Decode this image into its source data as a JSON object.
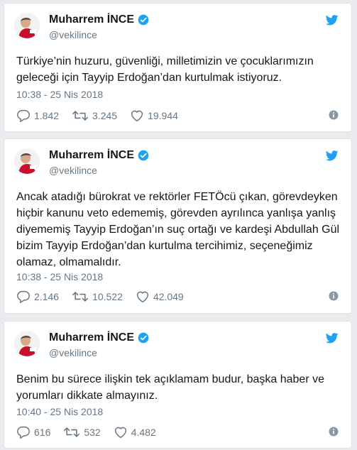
{
  "colors": {
    "accent": "#1da1f2",
    "text": "#14171a",
    "muted": "#657786",
    "verified": "#1da1f2"
  },
  "tweets": [
    {
      "name": "Muharrem İNCE",
      "handle": "@vekilince",
      "text": "Türkiye’nin huzuru, güvenliği, milletimizin ve çocuklarımızın geleceği için Tayyip Erdoğan’dan kurtulmak istiyoruz.",
      "timestamp": "10:38 - 25 Nis 2018",
      "replies": "1.842",
      "retweets": "3.245",
      "likes": "19.944"
    },
    {
      "name": "Muharrem İNCE",
      "handle": "@vekilince",
      "text": "Ancak atadığı bürokrat ve rektörler FETÖcü çıkan, görevdeyken hiçbir kanunu veto edememiş, görevden ayrılınca yanlışa yanlış diyememiş Tayyip Erdoğan’ın suç ortağı ve kardeşi Abdullah Gül bizim Tayyip Erdoğan’dan kurtulma tercihimiz, seçeneğimiz olamaz, olmamalıdır.",
      "timestamp": "10:38 - 25 Nis 2018",
      "replies": "2.146",
      "retweets": "10.522",
      "likes": "42.049"
    },
    {
      "name": "Muharrem İNCE",
      "handle": "@vekilince",
      "text": "Benim bu sürece ilişkin tek açıklamam budur, başka haber ve yorumları dikkate almayınız.",
      "timestamp": "10:40 - 25 Nis 2018",
      "replies": "616",
      "retweets": "532",
      "likes": "4.482"
    }
  ]
}
